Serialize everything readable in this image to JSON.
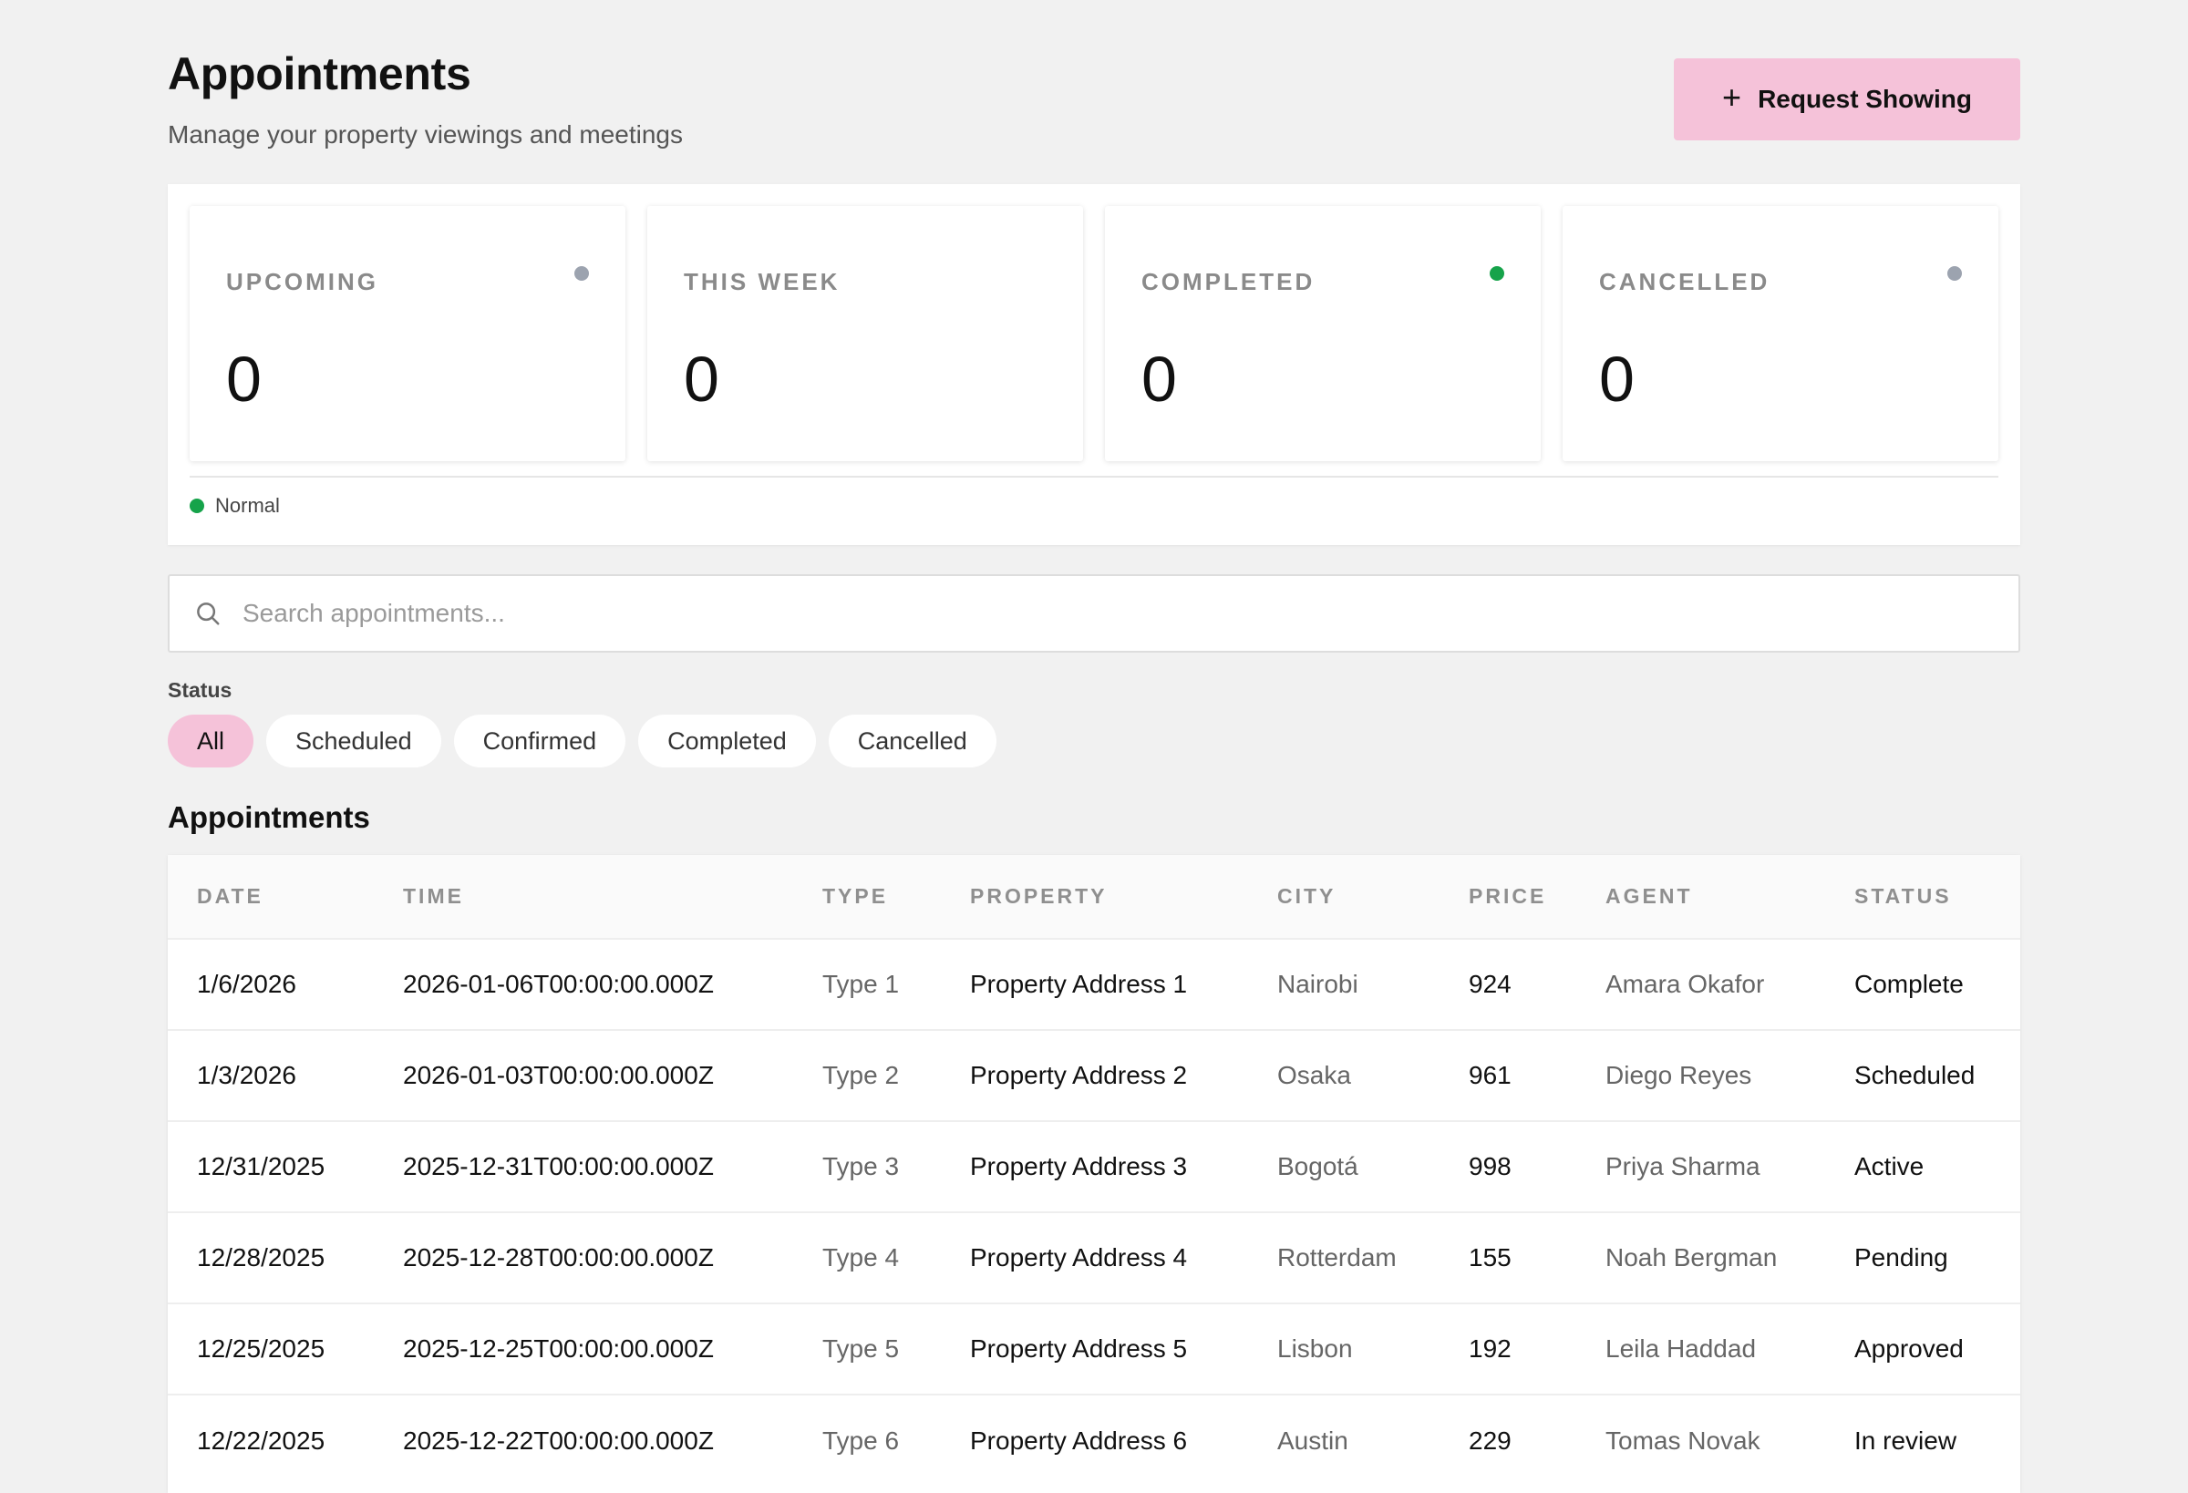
{
  "header": {
    "title": "Appointments",
    "subtitle": "Manage your property viewings and meetings",
    "primary_button": {
      "icon": "plus-icon",
      "label": "Request Showing"
    }
  },
  "stats": [
    {
      "label": "UPCOMING",
      "value": "0",
      "dot_color": "#9ca3af"
    },
    {
      "label": "THIS WEEK",
      "value": "0",
      "dot_color": null
    },
    {
      "label": "COMPLETED",
      "value": "0",
      "dot_color": "#16a34a"
    },
    {
      "label": "CANCELLED",
      "value": "0",
      "dot_color": "#9ca3af"
    }
  ],
  "legend": {
    "label": "Normal",
    "color": "#16a34a"
  },
  "search": {
    "placeholder": "Search appointments...",
    "value": "",
    "icon": "search-icon"
  },
  "filter": {
    "label": "Status",
    "options": [
      "All",
      "Scheduled",
      "Confirmed",
      "Completed",
      "Cancelled"
    ],
    "selected": "All"
  },
  "table": {
    "title": "Appointments",
    "columns": [
      "DATE",
      "TIME",
      "TYPE",
      "PROPERTY",
      "CITY",
      "PRICE",
      "AGENT",
      "STATUS"
    ],
    "rows": [
      [
        "1/6/2026",
        "2026-01-06T00:00:00.000Z",
        "Type 1",
        "Property Address 1",
        "Nairobi",
        "924",
        "Amara Okafor",
        "Complete"
      ],
      [
        "1/3/2026",
        "2026-01-03T00:00:00.000Z",
        "Type 2",
        "Property Address 2",
        "Osaka",
        "961",
        "Diego Reyes",
        "Scheduled"
      ],
      [
        "12/31/2025",
        "2025-12-31T00:00:00.000Z",
        "Type 3",
        "Property Address 3",
        "Bogotá",
        "998",
        "Priya Sharma",
        "Active"
      ],
      [
        "12/28/2025",
        "2025-12-28T00:00:00.000Z",
        "Type 4",
        "Property Address 4",
        "Rotterdam",
        "155",
        "Noah Bergman",
        "Pending"
      ],
      [
        "12/25/2025",
        "2025-12-25T00:00:00.000Z",
        "Type 5",
        "Property Address 5",
        "Lisbon",
        "192",
        "Leila Haddad",
        "Approved"
      ],
      [
        "12/22/2025",
        "2025-12-22T00:00:00.000Z",
        "Type 6",
        "Property Address 6",
        "Austin",
        "229",
        "Tomas Novak",
        "In review"
      ]
    ]
  },
  "colors": {
    "accent": "#f5c2d9",
    "background": "#f1f1f1",
    "success": "#16a34a",
    "neutral_dot": "#9ca3af"
  }
}
